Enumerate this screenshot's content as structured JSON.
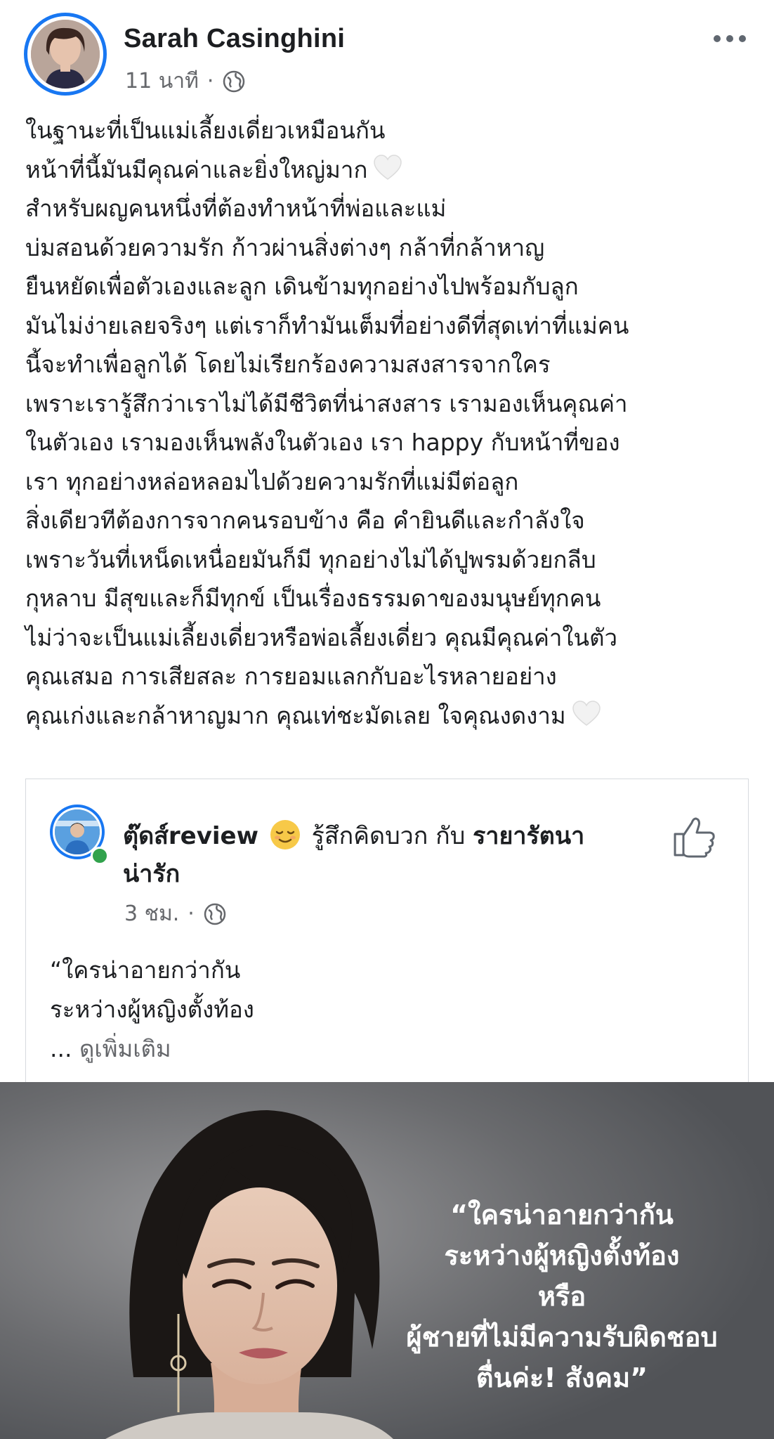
{
  "post": {
    "author": "Sarah Casinghini",
    "time": "11 นาที",
    "separator": "·",
    "lines": [
      "ในฐานะที่เป็นแม่เลี้ยงเดี่ยวเหมือนกัน",
      "หน้าที่นี้มันมีคุณค่าและยิ่งใหญ่มาก",
      "สำหรับผญคนหนึ่งที่ต้องทำหน้าที่พ่อและแม่",
      "บ่มสอนด้วยความรัก ก้าวผ่านสิ่งต่างๆ กล้าที่กล้าหาญ",
      "ยืนหยัดเพื่อตัวเองและลูก เดินข้ามทุกอย่างไปพร้อมกับลูก",
      "มันไม่ง่ายเลยจริงๆ แต่เราก็ทำมันเต็มที่อย่างดีที่สุดเท่าที่แม่คน",
      "นี้จะทำเพื่อลูกได้ โดยไม่เรียกร้องความสงสารจากใคร",
      "เพราะเรารู้สึกว่าเราไม่ได้มีชีวิตที่น่าสงสาร เรามองเห็นคุณค่า",
      "ในตัวเอง เรามองเห็นพลังในตัวเอง เรา happy กับหน้าที่ของ",
      "เรา ทุกอย่างหล่อหลอมไปด้วยความรักที่แม่มีต่อลูก",
      "สิ่งเดียวทีต้องการจากคนรอบข้าง คือ คำยินดีและกำลังใจ",
      "เพราะวันที่เหน็ดเหนื่อยมันก็มี ทุกอย่างไม่ได้ปูพรมด้วยกลีบ",
      "กุหลาบ มีสุขและก็มีทุกข์ เป็นเรื่องธรรมดาของมนุษย์ทุกคน",
      "ไม่ว่าจะเป็นแม่เลี้ยงเดี่ยวหรือพ่อเลี้ยงเดี่ยว คุณมีคุณค่าในตัว",
      "คุณเสมอ การเสียสละ การยอมแลกกับอะไรหลายอย่าง",
      "คุณเก่งและกล้าหาญมาก คุณเท่ชะมัดเลย ใจคุณงดงาม"
    ],
    "icons": {
      "globe": "globe-icon",
      "more": "more-options-icon",
      "heart": "white-heart-emoji"
    }
  },
  "shared": {
    "author": "ตุ๊ดส์review",
    "feeling": "รู้สึกคิดบวก กับ",
    "tagged_line1": "รายารัตนา",
    "tagged_line2": "น่ารัก",
    "time": "3 ชม.",
    "separator": "·",
    "text_line1": "“ใครน่าอายกว่ากัน",
    "text_line2": "ระหว่างผู้หญิงตั้งท้อง",
    "ellipsis": "...",
    "see_more": "ดูเพิ่มเติม",
    "icons": {
      "emoji": "relieved-face-emoji",
      "like": "like-thumb-icon",
      "globe": "globe-icon"
    },
    "colors": {
      "online": "#31a24c",
      "ring": "#1877f2"
    }
  },
  "image": {
    "overlay_lines": [
      "“ใครน่าอายกว่ากัน",
      "ระหว่างผู้หญิงตั้งท้อง",
      "หรือ",
      "ผู้ชายที่ไม่มีความรับผิดชอบ",
      "ตื่นค่ะ! สังคม”"
    ]
  }
}
